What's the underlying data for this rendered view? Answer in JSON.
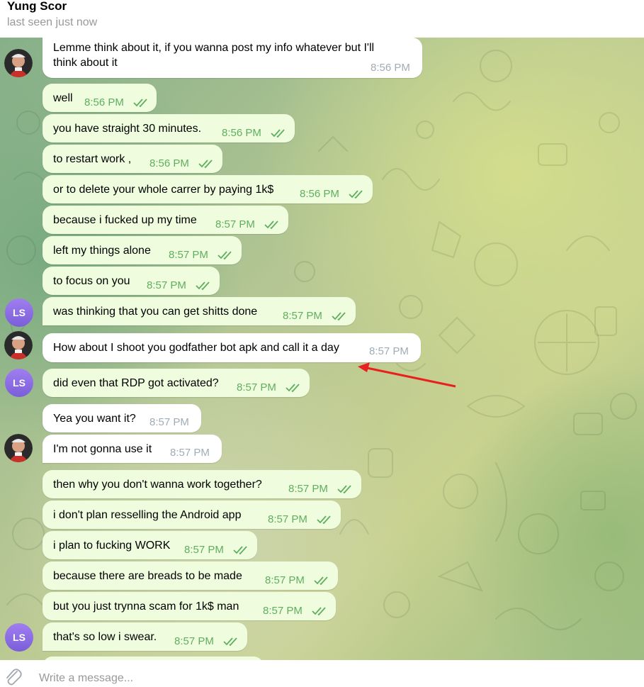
{
  "header": {
    "name": "Yung Scor",
    "status": "last seen just now"
  },
  "colors": {
    "outgoing_bubble": "#effdde",
    "incoming_bubble": "#ffffff",
    "outgoing_time": "#5fae5f",
    "incoming_time": "#a0acb6",
    "ls_avatar": "#8a6be3",
    "annotation_arrow": "#e8201f"
  },
  "avatars": {
    "ls_initials": "LS",
    "contact_avatar": "contact-photo-icon"
  },
  "messages": [
    {
      "dir": "in",
      "text": "Lemme think about it, if you wanna post my info whatever but I'll",
      "text2": "think about it",
      "time": "8:56 PM"
    },
    {
      "dir": "out",
      "text": "well",
      "time": "8:56 PM"
    },
    {
      "dir": "out",
      "text": "you have straight 30 minutes.",
      "time": "8:56 PM"
    },
    {
      "dir": "out",
      "text": "to restart work ,",
      "time": "8:56 PM"
    },
    {
      "dir": "out",
      "text": "or to delete your whole carrer by paying 1k$",
      "time": "8:56 PM"
    },
    {
      "dir": "out",
      "text": "because i fucked up my time",
      "time": "8:57 PM"
    },
    {
      "dir": "out",
      "text": "left my things alone",
      "time": "8:57 PM"
    },
    {
      "dir": "out",
      "text": "to focus on you",
      "time": "8:57 PM"
    },
    {
      "dir": "out",
      "text": "was thinking that you can get shitts done",
      "time": "8:57 PM"
    },
    {
      "dir": "in",
      "text": "How about I shoot you godfather bot apk and call it a day",
      "time": "8:57 PM"
    },
    {
      "dir": "out",
      "text": "did even that RDP got activated?",
      "time": "8:57 PM"
    },
    {
      "dir": "in",
      "text": "Yea you want it?",
      "time": "8:57 PM"
    },
    {
      "dir": "in",
      "text": "I'm not gonna use it",
      "time": "8:57 PM"
    },
    {
      "dir": "out",
      "text": "then why you don't wanna work together?",
      "time": "8:57 PM"
    },
    {
      "dir": "out",
      "text": "i don't plan resselling the Android app",
      "time": "8:57 PM"
    },
    {
      "dir": "out",
      "text": "i plan to fucking WORK",
      "time": "8:57 PM"
    },
    {
      "dir": "out",
      "text": "because there are breads to be made",
      "time": "8:57 PM"
    },
    {
      "dir": "out",
      "text": "but you just trynna scam for 1k$ man",
      "time": "8:57 PM"
    },
    {
      "dir": "out",
      "text": "that's so low i swear.",
      "time": "8:57 PM"
    }
  ],
  "composer": {
    "placeholder": "Write a message..."
  }
}
